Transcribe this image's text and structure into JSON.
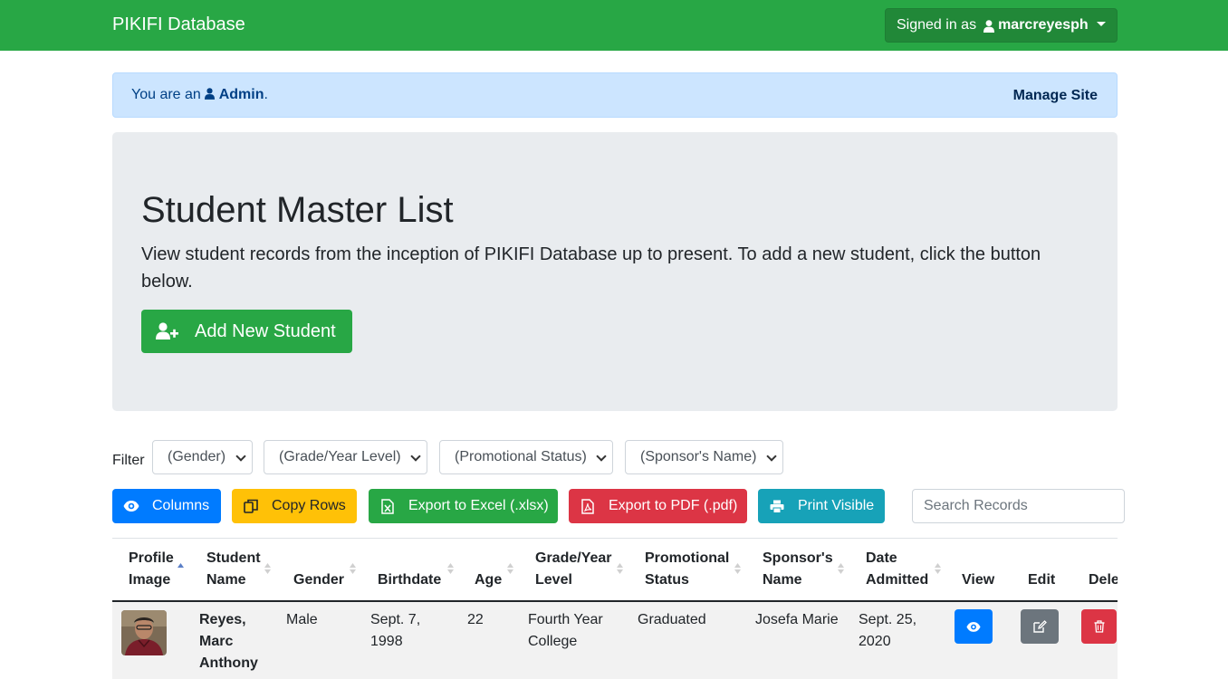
{
  "navbar": {
    "brand": "PIKIFI Database",
    "signed_in_prefix": "Signed in as",
    "username": "marcreyesph"
  },
  "alert": {
    "prefix": "You are an",
    "role": "Admin",
    "suffix": ".",
    "manage_link": "Manage Site"
  },
  "jumbotron": {
    "title": "Student Master List",
    "description": "View student records from the inception of PIKIFI Database up to present. To add a new student, click the button below.",
    "add_button": "Add New Student"
  },
  "filters": {
    "label": "Filter",
    "gender": "(Gender)",
    "grade": "(Grade/Year Level)",
    "status": "(Promotional Status)",
    "sponsor": "(Sponsor's Name)"
  },
  "toolbar": {
    "columns": "Columns",
    "copy": "Copy Rows",
    "excel": "Export to Excel (.xlsx)",
    "pdf": "Export to PDF (.pdf)",
    "print": "Print Visible",
    "search_placeholder": "Search Records"
  },
  "table": {
    "headers": {
      "profile_image": [
        "Profile",
        "Image"
      ],
      "student_name": [
        "Student",
        "Name"
      ],
      "gender": "Gender",
      "birthdate": "Birthdate",
      "age": "Age",
      "grade": [
        "Grade/Year",
        "Level"
      ],
      "status": [
        "Promotional",
        "Status"
      ],
      "sponsor": [
        "Sponsor's",
        "Name"
      ],
      "date_admitted": [
        "Date",
        "Admitted"
      ],
      "view": "View",
      "edit": "Edit",
      "delete": "Dele"
    },
    "rows": [
      {
        "name": [
          "Reyes,",
          "Marc",
          "Anthony"
        ],
        "gender": "Male",
        "birthdate": [
          "Sept. 7,",
          "1998"
        ],
        "age": "22",
        "grade": [
          "Fourth Year",
          "College"
        ],
        "status": "Graduated",
        "sponsor": "Josefa Marie",
        "date_admitted": [
          "Sept. 25,",
          "2020"
        ]
      }
    ]
  },
  "colors": {
    "success": "#28a745",
    "primary": "#007bff",
    "warning": "#ffc107",
    "danger": "#dc3545",
    "info": "#17a2b8",
    "secondary": "#6c757d",
    "alert_bg": "#cce5ff"
  }
}
